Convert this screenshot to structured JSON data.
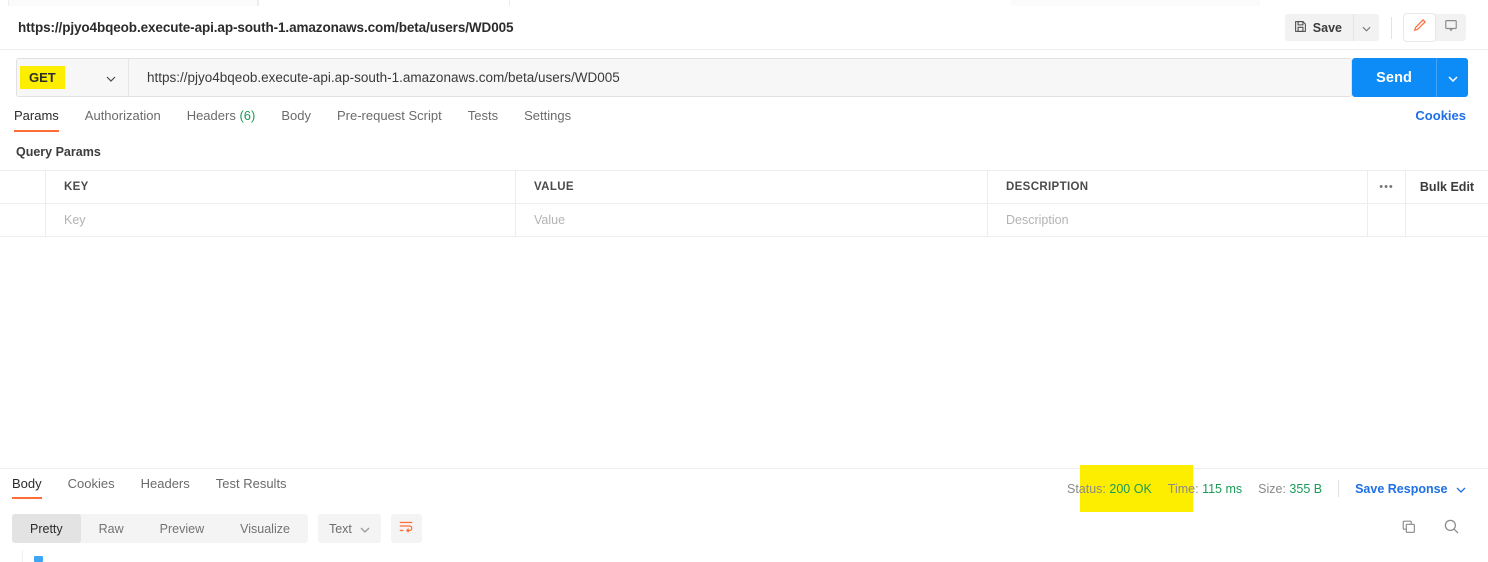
{
  "request": {
    "title": "https://pjyo4bqeob.execute-api.ap-south-1.amazonaws.com/beta/users/WD005",
    "method": "GET",
    "url": "https://pjyo4bqeob.execute-api.ap-south-1.amazonaws.com/beta/users/WD005",
    "send_label": "Send",
    "save_label": "Save"
  },
  "request_tabs": [
    {
      "label": "Params",
      "active": true
    },
    {
      "label": "Authorization",
      "active": false
    },
    {
      "label": "Headers",
      "count": "(6)",
      "active": false
    },
    {
      "label": "Body",
      "active": false
    },
    {
      "label": "Pre-request Script",
      "active": false
    },
    {
      "label": "Tests",
      "active": false
    },
    {
      "label": "Settings",
      "active": false
    }
  ],
  "cookies_link": "Cookies",
  "query_params": {
    "section_label": "Query Params",
    "columns": [
      "KEY",
      "VALUE",
      "DESCRIPTION"
    ],
    "placeholder_row": [
      "Key",
      "Value",
      "Description"
    ],
    "bulk_edit_label": "Bulk Edit",
    "more_label": "•••"
  },
  "response_tabs": [
    {
      "label": "Body",
      "active": true
    },
    {
      "label": "Cookies",
      "active": false
    },
    {
      "label": "Headers",
      "active": false
    },
    {
      "label": "Test Results",
      "active": false
    }
  ],
  "status_bar": {
    "status_label": "Status:",
    "status_value": "200 OK",
    "time_label": "Time:",
    "time_value": "115 ms",
    "size_label": "Size:",
    "size_value": "355 B",
    "save_response_label": "Save Response"
  },
  "format_bar": {
    "modes": [
      {
        "label": "Pretty",
        "active": true
      },
      {
        "label": "Raw",
        "active": false
      },
      {
        "label": "Preview",
        "active": false
      },
      {
        "label": "Visualize",
        "active": false
      }
    ],
    "type": "Text"
  },
  "colors": {
    "accent_orange": "#ff6c37",
    "send_blue": "#0d8bf7",
    "link_blue": "#1f6fe5",
    "status_green": "#1a9b5a",
    "highlight_yellow": "#fdee00"
  }
}
